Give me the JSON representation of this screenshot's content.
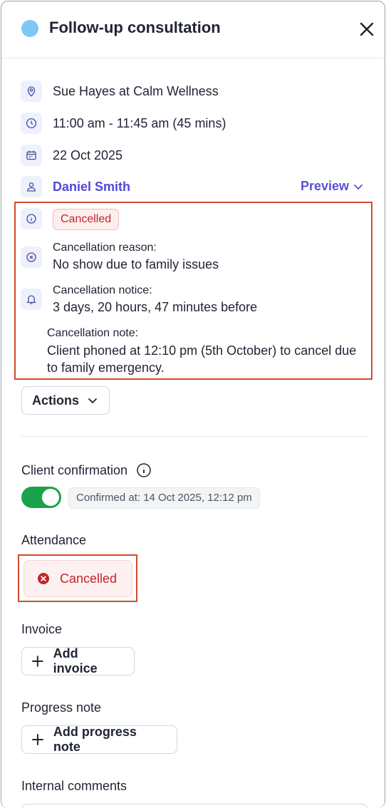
{
  "header": {
    "title": "Follow-up consultation",
    "dot_color": "#7cc8f6"
  },
  "details": {
    "location": "Sue Hayes at Calm Wellness",
    "time": "11:00 am - 11:45 am (45 mins)",
    "date": "22 Oct 2025",
    "client": "Daniel Smith",
    "preview_label": "Preview"
  },
  "cancellation": {
    "status_badge": "Cancelled",
    "reason_label": "Cancellation reason:",
    "reason_value": "No show due to family issues",
    "notice_label": "Cancellation notice:",
    "notice_value": "3 days, 20 hours, 47 minutes before",
    "note_label": "Cancellation note:",
    "note_value": "Client phoned at 12:10 pm (5th October) to cancel due to family emergency."
  },
  "actions": {
    "label": "Actions"
  },
  "client_confirmation": {
    "label": "Client confirmation",
    "toggle_on": true,
    "confirmed_text": "Confirmed at: 14 Oct 2025, 12:12 pm"
  },
  "attendance": {
    "label": "Attendance",
    "status": "Cancelled"
  },
  "invoice": {
    "label": "Invoice",
    "button": "Add invoice"
  },
  "progress_note": {
    "label": "Progress note",
    "button": "Add progress note"
  },
  "internal_comments": {
    "label": "Internal comments"
  },
  "colors": {
    "accent": "#5448d6",
    "danger": "#c0262d",
    "success": "#1aa34a",
    "highlight_outline": "#d14a2f"
  }
}
